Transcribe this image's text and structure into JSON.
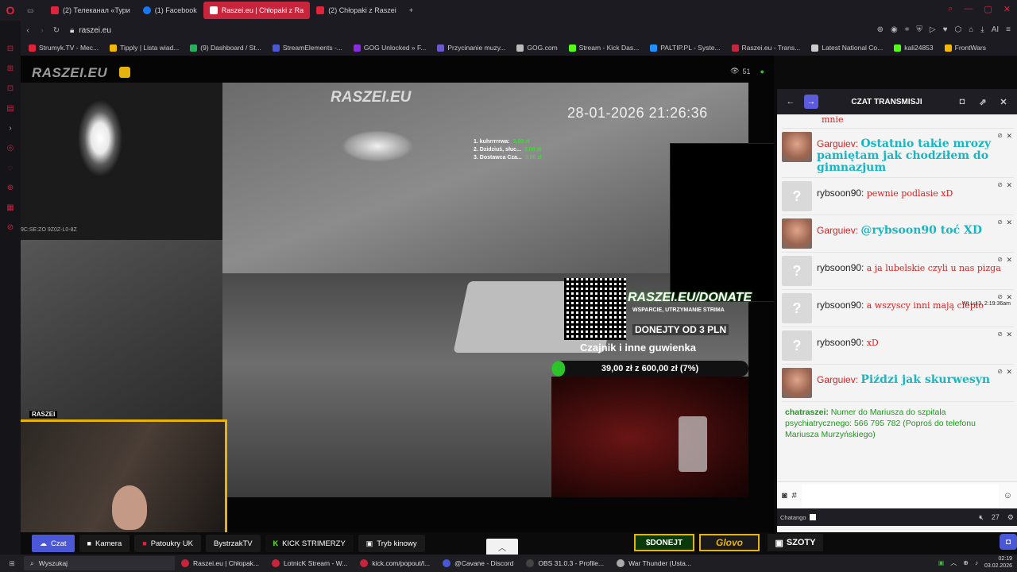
{
  "tabs": [
    {
      "label": "(2) Телеканал «Тури",
      "color": "#e0223a"
    },
    {
      "label": "(1) Facebook",
      "color": "#1877f2"
    },
    {
      "label": "Raszei.eu | Chłopaki z Ra",
      "color": "#c8243b",
      "active": true
    },
    {
      "label": "(2) Chłopaki z Raszei",
      "color": "#e0223a"
    }
  ],
  "new_tab": "+",
  "address": {
    "url": "raszei.eu"
  },
  "bookmarks": [
    {
      "label": "Strumyk.TV - Mec...",
      "color": "#e0223a"
    },
    {
      "label": "Tipply | Lista wiad...",
      "color": "#f5b800"
    },
    {
      "label": "(9) Dashboard / St...",
      "color": "#23b35c"
    },
    {
      "label": "StreamElements -...",
      "color": "#4a57d6"
    },
    {
      "label": "GOG Unlocked » F...",
      "color": "#8a2be2"
    },
    {
      "label": "Przycinanie muzy...",
      "color": "#6a5acd"
    },
    {
      "label": "GOG.com",
      "color": "#bbbbbb"
    },
    {
      "label": "Stream - Kick Das...",
      "color": "#53fc18"
    },
    {
      "label": "PALTIP.PL - Syste...",
      "color": "#1e90ff"
    },
    {
      "label": "Raszei.eu - Trans...",
      "color": "#c8243b"
    },
    {
      "label": "Latest National Co...",
      "color": "#cccccc"
    },
    {
      "label": "kali24853",
      "color": "#53fc18"
    },
    {
      "label": "FrontWars",
      "color": "#f5b800"
    }
  ],
  "stream": {
    "site_logo": "RASZEI.EU",
    "watermark": "RASZEI.EU",
    "timestamp": "28-01-2026 21:26:36",
    "cam_stamp": "9C:SE:ZO 9Z0Z-L0-8Z",
    "viewers": "51",
    "top_donors": [
      {
        "label": "1. kuhrrrrrwa:",
        "amount": "3,00 zł"
      },
      {
        "label": "2. Dzidziuś, słuc...",
        "amount": "3,00 zł"
      },
      {
        "label": "3. Dostawca Cza...",
        "amount": "3,00 zł"
      }
    ],
    "donate_url": "RASZEI.EU/DONATE",
    "donate_sub": "WSPARCIE, UTRZYMANIE STRIMA",
    "donate_min": "DONEJTY OD 3 PLN",
    "goal_name": "Czajnik i inne guwienka",
    "goal_text": "39,00 zł z 600,00 zł (7%)",
    "goal_fraction": 0.07,
    "webcam_label": "RASZEI"
  },
  "chat": {
    "title": "CZAT TRANSMISJI",
    "partial_top": "mnie",
    "messages": [
      {
        "name": "Garguiev:",
        "name_red": true,
        "text": "Ostatnio takie mrozy pamiętam jak chodziłem do gimnazjum",
        "style": "cyan",
        "photo": true
      },
      {
        "name": "rybsoon90:",
        "name_red": false,
        "text": "pewnie podlasie xD",
        "style": "red",
        "photo": false
      },
      {
        "name": "Garguiev:",
        "name_red": true,
        "text": "@rybsoon90 toć XD",
        "style": "cyan",
        "photo": true
      },
      {
        "name": "rybsoon90:",
        "name_red": false,
        "text": "a ja lubelskie czyli u nas pizga",
        "style": "red",
        "photo": false
      },
      {
        "name": "rybsoon90:",
        "name_red": false,
        "text": "a wszyscy inni mają ciepło",
        "style": "red",
        "photo": false,
        "stamp": "Wt Lu 3, 2:19:36am"
      },
      {
        "name": "rybsoon90:",
        "name_red": false,
        "text": "xD",
        "style": "red",
        "photo": false
      },
      {
        "name": "Garguiev:",
        "name_red": true,
        "text": "Piździ jak skurwesyn",
        "style": "cyan",
        "photo": true
      }
    ],
    "system_name": "chatraszei:",
    "system_text": "Numer do Mariusza do szpitala psychiatrycznego: 566 795 782 (Poproś do telefonu Mariusza Murzyńskiego)",
    "input_hash": "#",
    "footer_brand": "Chatango",
    "footer_count": "27"
  },
  "bottom_nav": [
    {
      "label": "Czat",
      "style": "blue",
      "icon": "☁"
    },
    {
      "label": "Kamera",
      "style": "dark",
      "icon": "■"
    },
    {
      "label": "Patoukry UK",
      "style": "dark",
      "icon": "■"
    },
    {
      "label": "BystrzakTV",
      "style": "dark",
      "icon": ""
    },
    {
      "label": "KICK STRIMERZY",
      "style": "kick",
      "icon": "K"
    },
    {
      "label": "Tryb kinowy",
      "style": "dark",
      "icon": "▣"
    }
  ],
  "buttons": {
    "donejt": "$DONEJT",
    "glovo": "Glovo",
    "szoty": "SZOTY"
  },
  "taskbar": {
    "search": "Wyszukaj",
    "tasks": [
      {
        "label": "Raszei.eu | Chłopak...",
        "color": "#c8243b"
      },
      {
        "label": "LotnicK Stream - W...",
        "color": "#c8243b"
      },
      {
        "label": "kick.com/popout/l...",
        "color": "#c8243b"
      },
      {
        "label": "@Cavane - Discord",
        "color": "#4a57d6"
      },
      {
        "label": "OBS 31.0.3 - Profile...",
        "color": "#444444"
      },
      {
        "label": "War Thunder (Ustа...",
        "color": "#aaaaaa"
      }
    ],
    "time": "02:19",
    "date": "03.02.2026"
  }
}
